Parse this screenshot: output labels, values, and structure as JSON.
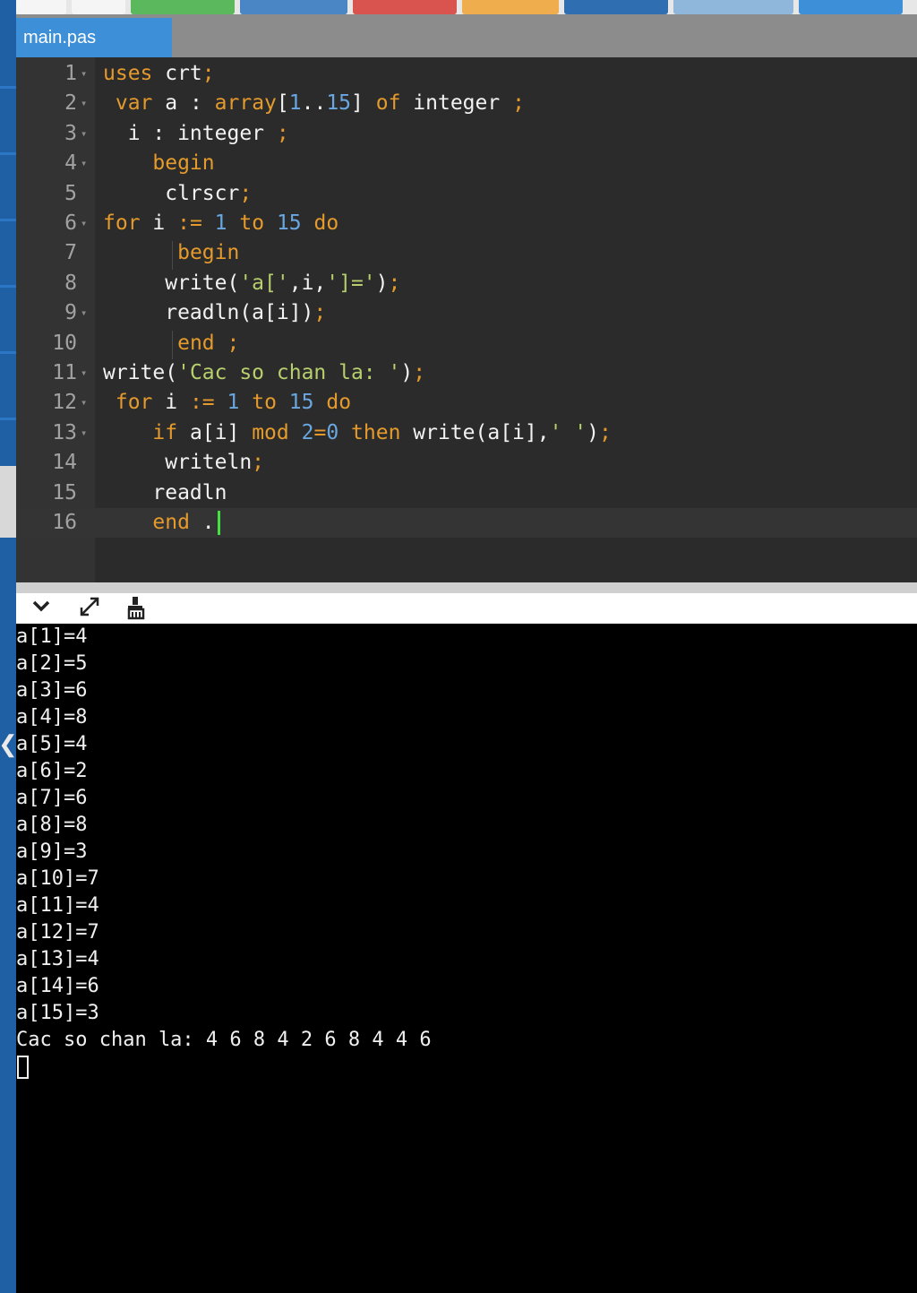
{
  "tab": {
    "filename": "main.pas"
  },
  "toolbar_buttons": [
    {
      "color": "#f5f5f5"
    },
    {
      "color": "#f5f5f5"
    },
    {
      "color": "#5cb85c"
    },
    {
      "color": "#4a86c5"
    },
    {
      "color": "#d9534f"
    },
    {
      "color": "#f0ad4e"
    },
    {
      "color": "#2f6fb1"
    },
    {
      "color": "#8fb7dc"
    },
    {
      "color": "#3d8fd8"
    }
  ],
  "editor": {
    "lines": [
      {
        "num": "1",
        "fold": true
      },
      {
        "num": "2",
        "fold": true
      },
      {
        "num": "3",
        "fold": true
      },
      {
        "num": "4",
        "fold": true
      },
      {
        "num": "5",
        "fold": false
      },
      {
        "num": "6",
        "fold": true
      },
      {
        "num": "7",
        "fold": false
      },
      {
        "num": "8",
        "fold": false
      },
      {
        "num": "9",
        "fold": true
      },
      {
        "num": "10",
        "fold": false
      },
      {
        "num": "11",
        "fold": true
      },
      {
        "num": "12",
        "fold": true
      },
      {
        "num": "13",
        "fold": true
      },
      {
        "num": "14",
        "fold": false
      },
      {
        "num": "15",
        "fold": false
      },
      {
        "num": "16",
        "fold": false
      }
    ],
    "code": [
      [
        [
          "kw",
          "uses"
        ],
        [
          "id",
          " crt"
        ],
        [
          "op",
          ";"
        ]
      ],
      [
        [
          "id",
          " "
        ],
        [
          "kw",
          "var"
        ],
        [
          "id",
          " a : "
        ],
        [
          "kw",
          "array"
        ],
        [
          "id",
          "["
        ],
        [
          "num",
          "1"
        ],
        [
          "id",
          ".."
        ],
        [
          "num",
          "15"
        ],
        [
          "id",
          "] "
        ],
        [
          "kw",
          "of"
        ],
        [
          "id",
          " integer "
        ],
        [
          "op",
          ";"
        ]
      ],
      [
        [
          "id",
          "  i : integer "
        ],
        [
          "op",
          ";"
        ]
      ],
      [
        [
          "id",
          "    "
        ],
        [
          "kw",
          "begin"
        ]
      ],
      [
        [
          "id",
          "     clrscr"
        ],
        [
          "op",
          ";"
        ]
      ],
      [
        [
          "kw",
          "for"
        ],
        [
          "id",
          " i "
        ],
        [
          "op",
          ":="
        ],
        [
          "id",
          " "
        ],
        [
          "num",
          "1"
        ],
        [
          "id",
          " "
        ],
        [
          "kw",
          "to"
        ],
        [
          "id",
          " "
        ],
        [
          "num",
          "15"
        ],
        [
          "id",
          " "
        ],
        [
          "kw",
          "do"
        ]
      ],
      [
        [
          "id",
          "      "
        ],
        [
          "kw",
          "begin"
        ]
      ],
      [
        [
          "id",
          "     write("
        ],
        [
          "str",
          "'a['"
        ],
        [
          "id",
          ",i,"
        ],
        [
          "str",
          "']='"
        ],
        [
          "id",
          ")"
        ],
        [
          "op",
          ";"
        ]
      ],
      [
        [
          "id",
          "     readln(a[i])"
        ],
        [
          "op",
          ";"
        ]
      ],
      [
        [
          "id",
          "      "
        ],
        [
          "kw",
          "end"
        ],
        [
          "id",
          " "
        ],
        [
          "op",
          ";"
        ]
      ],
      [
        [
          "id",
          "write("
        ],
        [
          "str",
          "'Cac so chan la: '"
        ],
        [
          "id",
          ")"
        ],
        [
          "op",
          ";"
        ]
      ],
      [
        [
          "id",
          " "
        ],
        [
          "kw",
          "for"
        ],
        [
          "id",
          " i "
        ],
        [
          "op",
          ":="
        ],
        [
          "id",
          " "
        ],
        [
          "num",
          "1"
        ],
        [
          "id",
          " "
        ],
        [
          "kw",
          "to"
        ],
        [
          "id",
          " "
        ],
        [
          "num",
          "15"
        ],
        [
          "id",
          " "
        ],
        [
          "kw",
          "do"
        ]
      ],
      [
        [
          "id",
          "    "
        ],
        [
          "kw",
          "if"
        ],
        [
          "id",
          " a[i] "
        ],
        [
          "kw",
          "mod"
        ],
        [
          "id",
          " "
        ],
        [
          "num",
          "2"
        ],
        [
          "op",
          "="
        ],
        [
          "num",
          "0"
        ],
        [
          "id",
          " "
        ],
        [
          "kw",
          "then"
        ],
        [
          "id",
          " write(a[i],"
        ],
        [
          "str",
          "' '"
        ],
        [
          "id",
          ")"
        ],
        [
          "op",
          ";"
        ]
      ],
      [
        [
          "id",
          "     writeln"
        ],
        [
          "op",
          ";"
        ]
      ],
      [
        [
          "id",
          "    readln"
        ]
      ],
      [
        [
          "id",
          "    "
        ],
        [
          "kw",
          "end"
        ],
        [
          "id",
          " ."
        ]
      ]
    ]
  },
  "console_toolbar": {
    "icons": [
      "chevron-down-icon",
      "expand-icon",
      "clear-console-icon"
    ]
  },
  "console": {
    "lines": [
      "a[1]=4",
      "a[2]=5",
      "a[3]=6",
      "a[4]=8",
      "a[5]=4",
      "a[6]=2",
      "a[7]=6",
      "a[8]=8",
      "a[9]=3",
      "a[10]=7",
      "a[11]=4",
      "a[12]=7",
      "a[13]=4",
      "a[14]=6",
      "a[15]=3",
      "Cac so chan la: 4 6 8 4 2 6 8 4 4 6"
    ]
  }
}
